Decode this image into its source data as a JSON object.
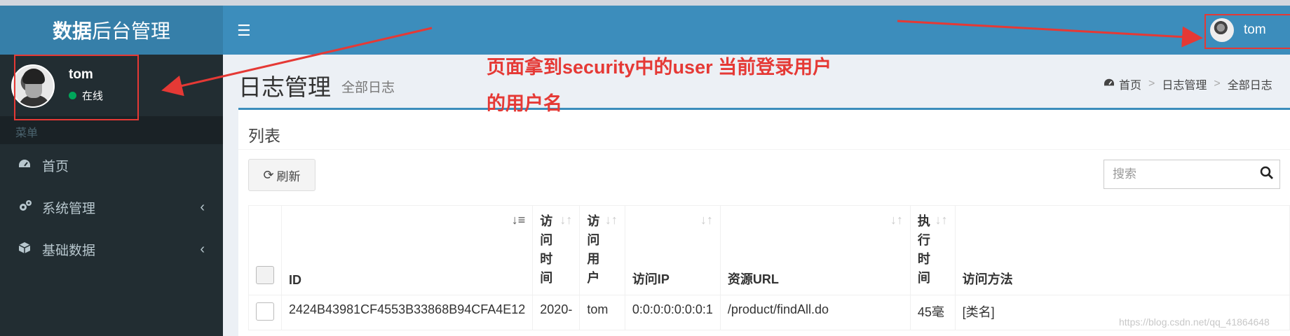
{
  "app": {
    "logo_bold": "数据",
    "logo_rest": "后台管理"
  },
  "header": {
    "menu_icon": "hamburger-icon",
    "user_name": "tom"
  },
  "sidebar": {
    "user": {
      "name": "tom",
      "status": "在线",
      "status_color": "#00a65a"
    },
    "menu_header": "菜单",
    "items": [
      {
        "label": "首页",
        "icon": "dashboard-icon"
      },
      {
        "label": "系统管理",
        "icon": "gears-icon"
      },
      {
        "label": "基础数据",
        "icon": "cube-icon"
      }
    ]
  },
  "content": {
    "title": "日志管理",
    "subtitle": "全部日志",
    "breadcrumb": [
      "首页",
      "日志管理",
      "全部日志"
    ]
  },
  "box": {
    "title": "列表",
    "refresh_label": "刷新",
    "search_placeholder": "搜索",
    "columns": [
      "ID",
      "访问时间",
      "访问用户",
      "访问IP",
      "资源URL",
      "执行时间",
      "访问方法"
    ],
    "rows": [
      {
        "id": "2424B43981CF4553B33868B94CFA4E12",
        "time": "2020-",
        "user": "tom",
        "ip": "0:0:0:0:0:0:0:1",
        "url": "/product/findAll.do",
        "exec": "45毫",
        "method": "[类名]"
      }
    ]
  },
  "annotation": {
    "line1": "页面拿到security中的user 当前登录用户",
    "line2": "的用户名",
    "color": "#e53935"
  },
  "watermark": "https://blog.csdn.net/qq_41864648"
}
